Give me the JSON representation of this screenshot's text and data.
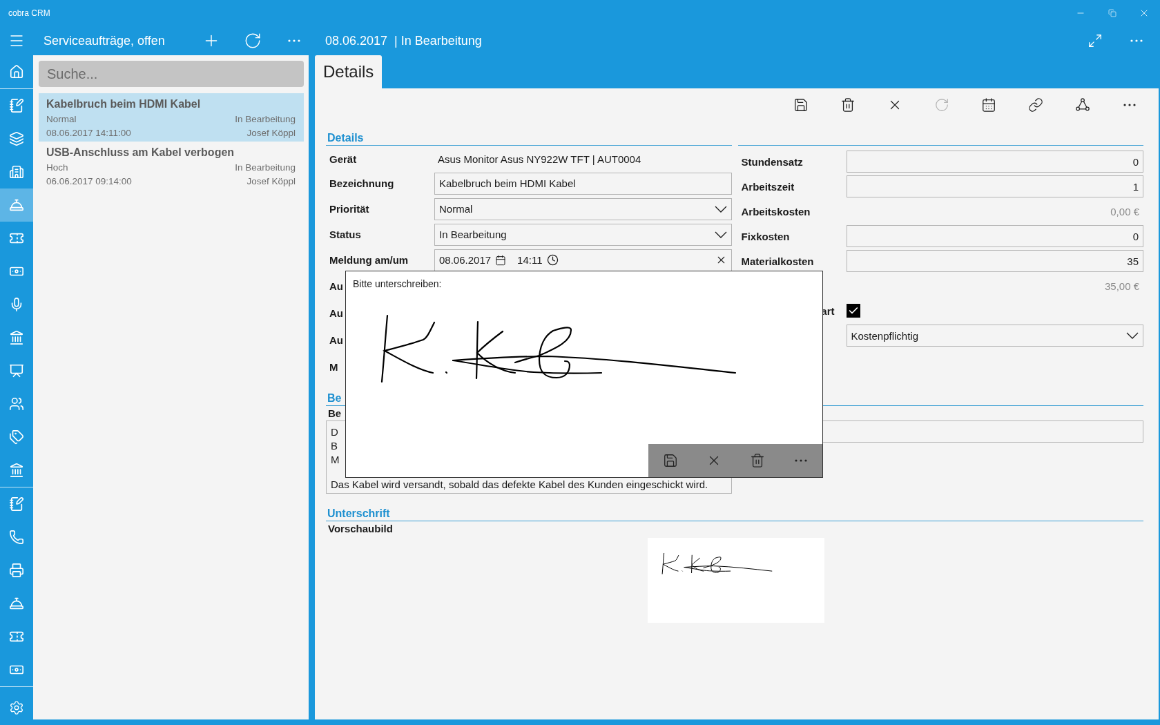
{
  "window": {
    "title": "cobra CRM"
  },
  "nav": {
    "groups": [
      {
        "items": [
          {
            "kind": "home",
            "selected": false
          }
        ]
      },
      {
        "items": [
          {
            "kind": "notebook",
            "selected": false
          },
          {
            "kind": "stack",
            "selected": false
          },
          {
            "kind": "desk",
            "selected": false
          },
          {
            "kind": "bell",
            "selected": true
          },
          {
            "kind": "ticket",
            "selected": false
          },
          {
            "kind": "banknote",
            "selected": false
          },
          {
            "kind": "microphone",
            "selected": false
          },
          {
            "kind": "bank",
            "selected": false
          },
          {
            "kind": "presenter",
            "selected": false
          },
          {
            "kind": "people",
            "selected": false
          },
          {
            "kind": "tags",
            "selected": false
          },
          {
            "kind": "bank",
            "selected": false
          }
        ]
      },
      {
        "items": [
          {
            "kind": "notebook",
            "selected": false
          },
          {
            "kind": "phone",
            "selected": false
          },
          {
            "kind": "printer",
            "selected": false
          },
          {
            "kind": "bell",
            "selected": false
          },
          {
            "kind": "ticket",
            "selected": false
          },
          {
            "kind": "banknote",
            "selected": false
          }
        ]
      }
    ],
    "settings": {
      "kind": "settings"
    }
  },
  "list": {
    "title": "Serviceaufträge, offen",
    "actions": [
      {
        "kind": "add"
      },
      {
        "kind": "refresh"
      },
      {
        "kind": "more"
      }
    ],
    "search": {
      "placeholder": "Suche..."
    },
    "records": [
      {
        "title": "Kabelbruch beim HDMI Kabel",
        "priority": "Normal",
        "status": "In Bearbeitung",
        "date": "08.06.2017 14:11:00",
        "owner": "Josef Köppl",
        "selected": true
      },
      {
        "title": "USB-Anschluss am Kabel verbogen",
        "priority": "Hoch",
        "status": "In Bearbeitung",
        "date": "06.06.2017 09:14:00",
        "owner": "Josef Köppl",
        "selected": false
      }
    ]
  },
  "detail": {
    "date": "08.06.2017",
    "status": "| In Bearbeitung",
    "actions": [
      {
        "kind": "expand"
      },
      {
        "kind": "more"
      }
    ],
    "tabs": [
      {
        "label": "Details",
        "selected": true
      }
    ],
    "toolbar": [
      {
        "kind": "save",
        "disabled": false
      },
      {
        "kind": "delete",
        "disabled": false
      },
      {
        "kind": "close",
        "disabled": false
      },
      {
        "kind": "refresh",
        "disabled": true
      },
      {
        "kind": "calendar",
        "disabled": false
      },
      {
        "kind": "link",
        "disabled": false
      },
      {
        "kind": "share",
        "disabled": false
      },
      {
        "kind": "more",
        "disabled": false
      }
    ],
    "details_section": {
      "title": "Details",
      "left_fields": [
        {
          "kind": "text",
          "label": "Gerät",
          "value": "Asus Monitor Asus NY922W TFT | AUT0004"
        },
        {
          "kind": "input",
          "label": "Bezeichnung",
          "value": "Kabelbruch beim HDMI Kabel"
        },
        {
          "kind": "select",
          "label": "Priorität",
          "value": "Normal"
        },
        {
          "kind": "select",
          "label": "Status",
          "value": "In Bearbeitung"
        },
        {
          "kind": "datetime",
          "label": "Meldung am/um",
          "date": "08.06.2017",
          "time": "14:11"
        },
        {
          "kind": "hidden",
          "label": "Au"
        },
        {
          "kind": "hidden",
          "label": "Au"
        },
        {
          "kind": "hidden",
          "label": "Au"
        },
        {
          "kind": "hidden",
          "label": "M"
        }
      ],
      "right_fields": [
        {
          "kind": "number",
          "label": "Stundensatz",
          "value": "0"
        },
        {
          "kind": "number",
          "label": "Arbeitszeit",
          "value": "1"
        },
        {
          "kind": "amount",
          "label": "Arbeitskosten",
          "value": "0,00 €"
        },
        {
          "kind": "number",
          "label": "Fixkosten",
          "value": "0"
        },
        {
          "kind": "number",
          "label": "Materialkosten",
          "value": "35"
        },
        {
          "kind": "amount",
          "value": "35,00 €"
        },
        {
          "kind": "checkbox",
          "label": "art",
          "checked": true
        },
        {
          "kind": "select",
          "value": "Kostenpflichtig"
        }
      ]
    },
    "notes_section": {
      "title": "Be",
      "label": "Be",
      "lines": [
        "D",
        "B",
        "M"
      ],
      "last_line": "Das Kabel wird versandt, sobald das defekte Kabel des Kunden eingeschickt wird."
    },
    "signature_section": {
      "title": "Unterschrift",
      "label": "Vorschaubild"
    },
    "signature_dialog": {
      "prompt": "Bitte unterschreiben:",
      "toolbar": [
        {
          "kind": "save"
        },
        {
          "kind": "close"
        },
        {
          "kind": "delete"
        },
        {
          "kind": "more"
        }
      ]
    }
  }
}
